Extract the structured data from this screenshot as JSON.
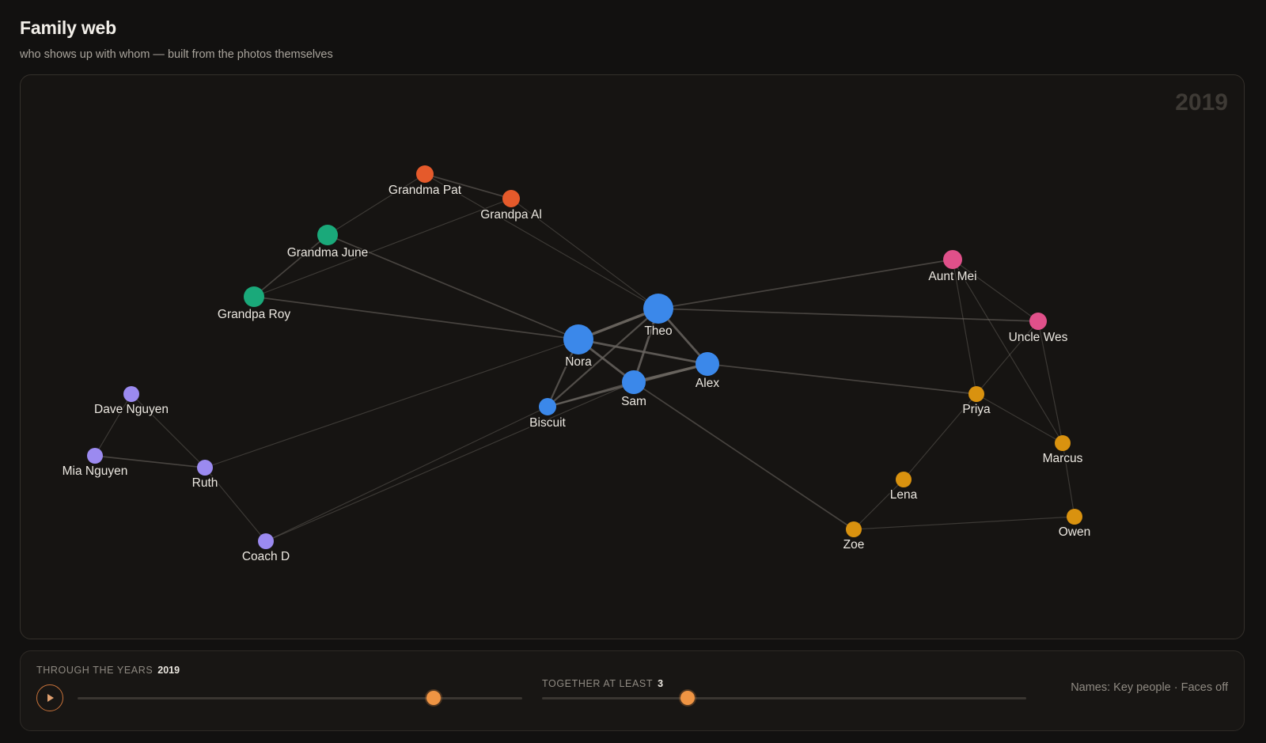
{
  "header": {
    "title": "Family web",
    "subtitle": "who shows up with whom — built from the photos themselves"
  },
  "graph": {
    "year": "2019",
    "colors": {
      "grandparents_dad": "#e55a2b",
      "grandparents_mom": "#1aa97a",
      "core": "#3b88ea",
      "aunt_uncle": "#e0508a",
      "neighbors": "#9b8af0",
      "friends": "#d9920f",
      "edge": "#6a6560"
    },
    "nodes": [
      {
        "id": "grandma-pat",
        "label": "Grandma Pat",
        "group": "grandparents_dad"
      },
      {
        "id": "grandpa-al",
        "label": "Grandpa Al",
        "group": "grandparents_dad"
      },
      {
        "id": "grandma-june",
        "label": "Grandma June",
        "group": "grandparents_mom"
      },
      {
        "id": "grandpa-roy",
        "label": "Grandpa Roy",
        "group": "grandparents_mom"
      },
      {
        "id": "theo",
        "label": "Theo",
        "group": "core"
      },
      {
        "id": "nora",
        "label": "Nora",
        "group": "core"
      },
      {
        "id": "alex",
        "label": "Alex",
        "group": "core"
      },
      {
        "id": "sam",
        "label": "Sam",
        "group": "core"
      },
      {
        "id": "biscuit",
        "label": "Biscuit",
        "group": "core"
      },
      {
        "id": "aunt-mei",
        "label": "Aunt Mei",
        "group": "aunt_uncle"
      },
      {
        "id": "uncle-wes",
        "label": "Uncle Wes",
        "group": "aunt_uncle"
      },
      {
        "id": "dave-nguyen",
        "label": "Dave Nguyen",
        "group": "neighbors"
      },
      {
        "id": "mia-nguyen",
        "label": "Mia Nguyen",
        "group": "neighbors"
      },
      {
        "id": "ruth",
        "label": "Ruth",
        "group": "neighbors"
      },
      {
        "id": "coach-d",
        "label": "Coach D",
        "group": "neighbors"
      },
      {
        "id": "priya",
        "label": "Priya",
        "group": "friends"
      },
      {
        "id": "marcus",
        "label": "Marcus",
        "group": "friends"
      },
      {
        "id": "lena",
        "label": "Lena",
        "group": "friends"
      },
      {
        "id": "zoe",
        "label": "Zoe",
        "group": "friends"
      },
      {
        "id": "owen",
        "label": "Owen",
        "group": "friends"
      }
    ],
    "edges": [
      {
        "source": "theo",
        "target": "nora",
        "weight": 5
      },
      {
        "source": "theo",
        "target": "alex",
        "weight": 4
      },
      {
        "source": "theo",
        "target": "sam",
        "weight": 4
      },
      {
        "source": "nora",
        "target": "alex",
        "weight": 4
      },
      {
        "source": "nora",
        "target": "sam",
        "weight": 4
      },
      {
        "source": "alex",
        "target": "sam",
        "weight": 5
      },
      {
        "source": "nora",
        "target": "biscuit",
        "weight": 3
      },
      {
        "source": "sam",
        "target": "biscuit",
        "weight": 3
      },
      {
        "source": "theo",
        "target": "biscuit",
        "weight": 3
      },
      {
        "source": "alex",
        "target": "biscuit",
        "weight": 3
      },
      {
        "source": "grandma-pat",
        "target": "grandpa-al",
        "weight": 2
      },
      {
        "source": "grandma-pat",
        "target": "grandma-june",
        "weight": 1
      },
      {
        "source": "grandpa-al",
        "target": "grandpa-roy",
        "weight": 1
      },
      {
        "source": "grandma-june",
        "target": "grandpa-roy",
        "weight": 2
      },
      {
        "source": "grandpa-al",
        "target": "theo",
        "weight": 1
      },
      {
        "source": "grandma-pat",
        "target": "theo",
        "weight": 1
      },
      {
        "source": "grandma-june",
        "target": "nora",
        "weight": 2
      },
      {
        "source": "grandpa-roy",
        "target": "nora",
        "weight": 2
      },
      {
        "source": "theo",
        "target": "aunt-mei",
        "weight": 2
      },
      {
        "source": "theo",
        "target": "uncle-wes",
        "weight": 2
      },
      {
        "source": "aunt-mei",
        "target": "uncle-wes",
        "weight": 1
      },
      {
        "source": "aunt-mei",
        "target": "priya",
        "weight": 1
      },
      {
        "source": "aunt-mei",
        "target": "marcus",
        "weight": 1
      },
      {
        "source": "uncle-wes",
        "target": "priya",
        "weight": 1
      },
      {
        "source": "uncle-wes",
        "target": "marcus",
        "weight": 1
      },
      {
        "source": "alex",
        "target": "priya",
        "weight": 2
      },
      {
        "source": "priya",
        "target": "marcus",
        "weight": 1
      },
      {
        "source": "priya",
        "target": "lena",
        "weight": 1
      },
      {
        "source": "lena",
        "target": "zoe",
        "weight": 1
      },
      {
        "source": "marcus",
        "target": "owen",
        "weight": 1
      },
      {
        "source": "zoe",
        "target": "owen",
        "weight": 1
      },
      {
        "source": "sam",
        "target": "zoe",
        "weight": 2
      },
      {
        "source": "dave-nguyen",
        "target": "mia-nguyen",
        "weight": 1
      },
      {
        "source": "dave-nguyen",
        "target": "ruth",
        "weight": 1
      },
      {
        "source": "mia-nguyen",
        "target": "ruth",
        "weight": 2
      },
      {
        "source": "ruth",
        "target": "coach-d",
        "weight": 1
      },
      {
        "source": "ruth",
        "target": "nora",
        "weight": 1
      },
      {
        "source": "coach-d",
        "target": "sam",
        "weight": 1
      },
      {
        "source": "coach-d",
        "target": "biscuit",
        "weight": 1
      }
    ]
  },
  "controls": {
    "years_label": "THROUGH THE YEARS",
    "years_value": "2019",
    "years_position": 0.8,
    "together_label": "TOGETHER AT LEAST",
    "together_value": "3",
    "together_position": 0.3,
    "names_note": "Names: Key people · Faces off"
  }
}
